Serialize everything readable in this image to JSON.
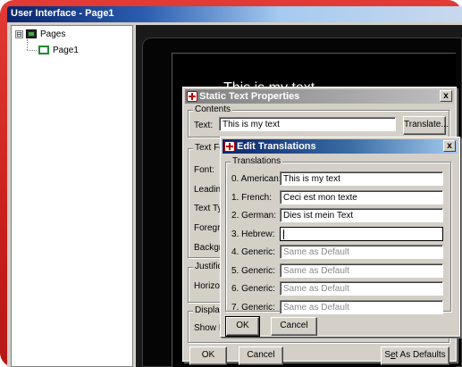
{
  "window": {
    "title": "User Interface - Page1"
  },
  "tree": {
    "root_label": "Pages",
    "expander": "⊟",
    "child_label": "Page1"
  },
  "canvas": {
    "text": "This is my text"
  },
  "static_dialog": {
    "title": "Static Text Properties",
    "close_label": "x",
    "contents_group": "Contents",
    "text_label": "Text:",
    "text_value": "This is my text",
    "translate_button": "Translate...",
    "text_format_group": "Text Fo",
    "font_label": "Font:",
    "leading_label": "Leadin",
    "text_type_label": "Text Ty",
    "foreground_label": "Foregro",
    "background_label": "Backgro",
    "justification_group": "Justifica",
    "horizontal_label": "Horizon",
    "display_group": "Display",
    "show_label": "Show It",
    "ok_button": "OK",
    "cancel_button": "Cancel",
    "set_defaults_pre": "S",
    "set_defaults_ul": "e",
    "set_defaults_post": "t As Defaults"
  },
  "translations_dialog": {
    "title": "Edit Translations",
    "close_label": "x",
    "group_label": "Translations",
    "rows": [
      {
        "label": "0. American:",
        "value": "This is my text",
        "placeholder": false
      },
      {
        "label": "1. French:",
        "value": "Ceci est mon texte",
        "placeholder": false
      },
      {
        "label": "2. German:",
        "value": "Dies ist mein Text",
        "placeholder": false
      },
      {
        "label": "3. Hebrew:",
        "value": "",
        "placeholder": false
      },
      {
        "label": "4. Generic:",
        "value": "Same as Default",
        "placeholder": true
      },
      {
        "label": "5. Generic:",
        "value": "Same as Default",
        "placeholder": true
      },
      {
        "label": "6. Generic:",
        "value": "Same as Default",
        "placeholder": true
      },
      {
        "label": "7. Generic:",
        "value": "Same as Default",
        "placeholder": true
      }
    ],
    "ok_button": "OK",
    "cancel_button": "Cancel"
  }
}
